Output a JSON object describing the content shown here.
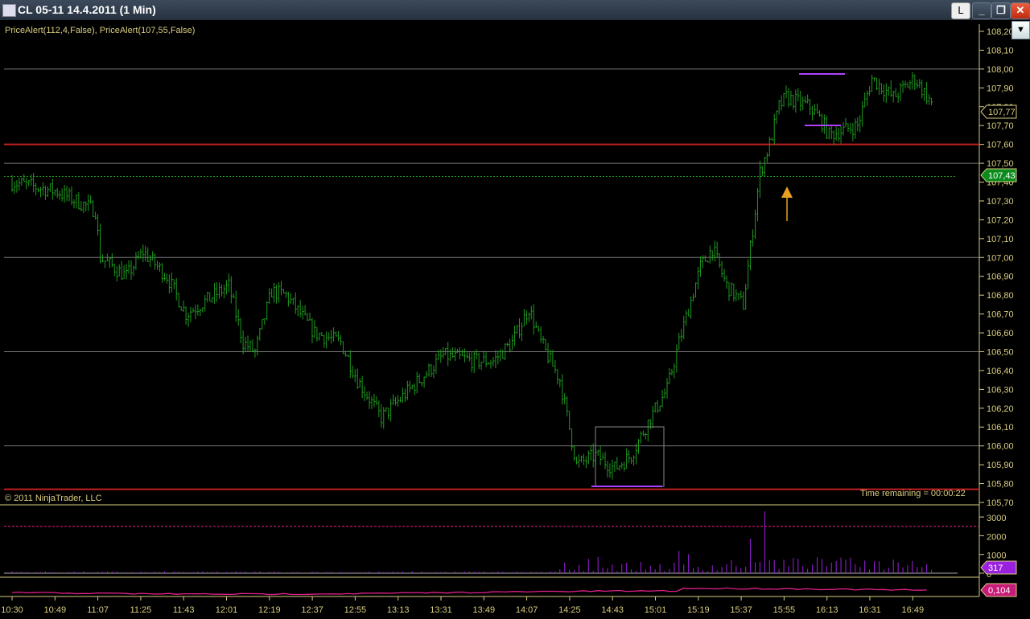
{
  "window": {
    "title": "CL 05-11  14.4.2011 (1 Min)",
    "btn_l": "L",
    "btn_min": "_",
    "btn_max": "❐",
    "btn_close": "✕",
    "dropdown": "▼"
  },
  "indicators_label": "PriceAlert(112,4,False), PriceAlert(107,55,False)",
  "copyright": "© 2011 NinjaTrader, LLC",
  "time_remaining": "Time remaining = 00:00:22",
  "colors": {
    "bars": "#1f9a1f",
    "axis": "#d8cc80",
    "alert": "#c02020",
    "volume": "#9a20e0",
    "indicator": "#e0208a"
  },
  "chart_data": {
    "type": "bar",
    "price_axis": {
      "ticks": [
        "108,20",
        "108,10",
        "108,00",
        "107,90",
        "107,80",
        "107,70",
        "107,60",
        "107,50",
        "107,40",
        "107,30",
        "107,20",
        "107,10",
        "107,00",
        "106,90",
        "106,80",
        "106,70",
        "106,60",
        "106,50",
        "106,40",
        "106,30",
        "106,20",
        "106,10",
        "106,00",
        "105,90",
        "105,80",
        "105,70"
      ],
      "range": [
        105.7,
        108.2
      ]
    },
    "last_price": "107,77",
    "alert_price_marker": "107,43",
    "alert_lines": [
      107.6,
      105.77
    ],
    "dotted_line": 107.43,
    "price_path": [
      [
        0,
        107.4
      ],
      [
        19,
        107.35
      ],
      [
        35,
        107.25
      ],
      [
        37,
        107.0
      ],
      [
        48,
        106.9
      ],
      [
        55,
        107.03
      ],
      [
        65,
        106.9
      ],
      [
        73,
        106.7
      ],
      [
        85,
        106.8
      ],
      [
        91,
        106.85
      ],
      [
        97,
        106.55
      ],
      [
        102,
        106.5
      ],
      [
        109,
        106.82
      ],
      [
        115,
        106.8
      ],
      [
        127,
        106.6
      ],
      [
        138,
        106.55
      ],
      [
        145,
        106.35
      ],
      [
        155,
        106.15
      ],
      [
        163,
        106.25
      ],
      [
        175,
        106.4
      ],
      [
        181,
        106.48
      ],
      [
        195,
        106.45
      ],
      [
        202,
        106.45
      ],
      [
        210,
        106.55
      ],
      [
        217,
        106.73
      ],
      [
        222,
        106.55
      ],
      [
        230,
        106.35
      ],
      [
        237,
        105.9
      ],
      [
        245,
        105.95
      ],
      [
        253,
        105.88
      ],
      [
        260,
        105.95
      ],
      [
        268,
        106.15
      ],
      [
        275,
        106.3
      ],
      [
        280,
        106.55
      ],
      [
        289,
        106.95
      ],
      [
        294,
        107.05
      ],
      [
        300,
        106.85
      ],
      [
        307,
        106.75
      ],
      [
        310,
        107.05
      ],
      [
        314,
        107.45
      ],
      [
        318,
        107.6
      ],
      [
        322,
        107.8
      ],
      [
        325,
        107.85
      ],
      [
        335,
        107.8
      ],
      [
        340,
        107.72
      ],
      [
        343,
        107.65
      ],
      [
        355,
        107.7
      ],
      [
        361,
        107.95
      ],
      [
        370,
        107.85
      ],
      [
        379,
        107.95
      ],
      [
        386,
        107.82
      ]
    ],
    "time_ticks": [
      "10:30",
      "10:49",
      "11:07",
      "11:25",
      "11:43",
      "12:01",
      "12:19",
      "12:37",
      "12:55",
      "13:13",
      "13:31",
      "13:49",
      "14:07",
      "14:25",
      "14:43",
      "15:01",
      "15:19",
      "15:37",
      "15:55",
      "16:13",
      "16:31",
      "16:49"
    ],
    "volume_axis": {
      "ticks": [
        "3000",
        "2000",
        "1000",
        "0"
      ],
      "range": [
        0,
        3500
      ]
    },
    "volume_last": "317",
    "volume_level": 2500,
    "indicator_last": "0,104"
  }
}
